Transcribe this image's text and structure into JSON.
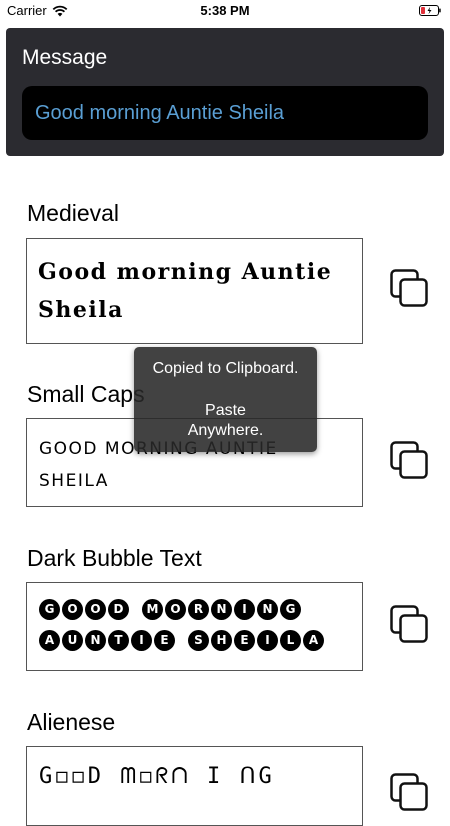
{
  "status_bar": {
    "carrier": "Carrier",
    "time": "5:38 PM"
  },
  "message": {
    "label": "Message",
    "value": "Good morning Auntie Sheila"
  },
  "styles": [
    {
      "title": "Medieval",
      "text_lines": [
        "Good morning Auntie",
        "Sheila"
      ]
    },
    {
      "title": "Small Caps",
      "text_lines": [
        "GOOD MORNING AUNTIE",
        "SHEILA"
      ]
    },
    {
      "title": "Dark Bubble Text",
      "bubble_lines": [
        [
          "G",
          "O",
          "O",
          "D",
          " ",
          "M",
          "O",
          "R",
          "N",
          "I",
          "N",
          "G"
        ],
        [
          "A",
          "U",
          "N",
          "T",
          "I",
          "E",
          " ",
          "S",
          "H",
          "E",
          "I",
          "L",
          "A"
        ]
      ]
    },
    {
      "title": "Alienese",
      "text_lines": [
        "G◻◻D ᗰ◻ᖇᑎ I ᑎG"
      ]
    }
  ],
  "toast": {
    "line1": "Copied to Clipboard.",
    "line2": "Paste",
    "line3": "Anywhere."
  },
  "colors": {
    "panel_bg": "#2b2b30",
    "input_text": "#5a9fd4",
    "battery_low": "#e0303a"
  }
}
